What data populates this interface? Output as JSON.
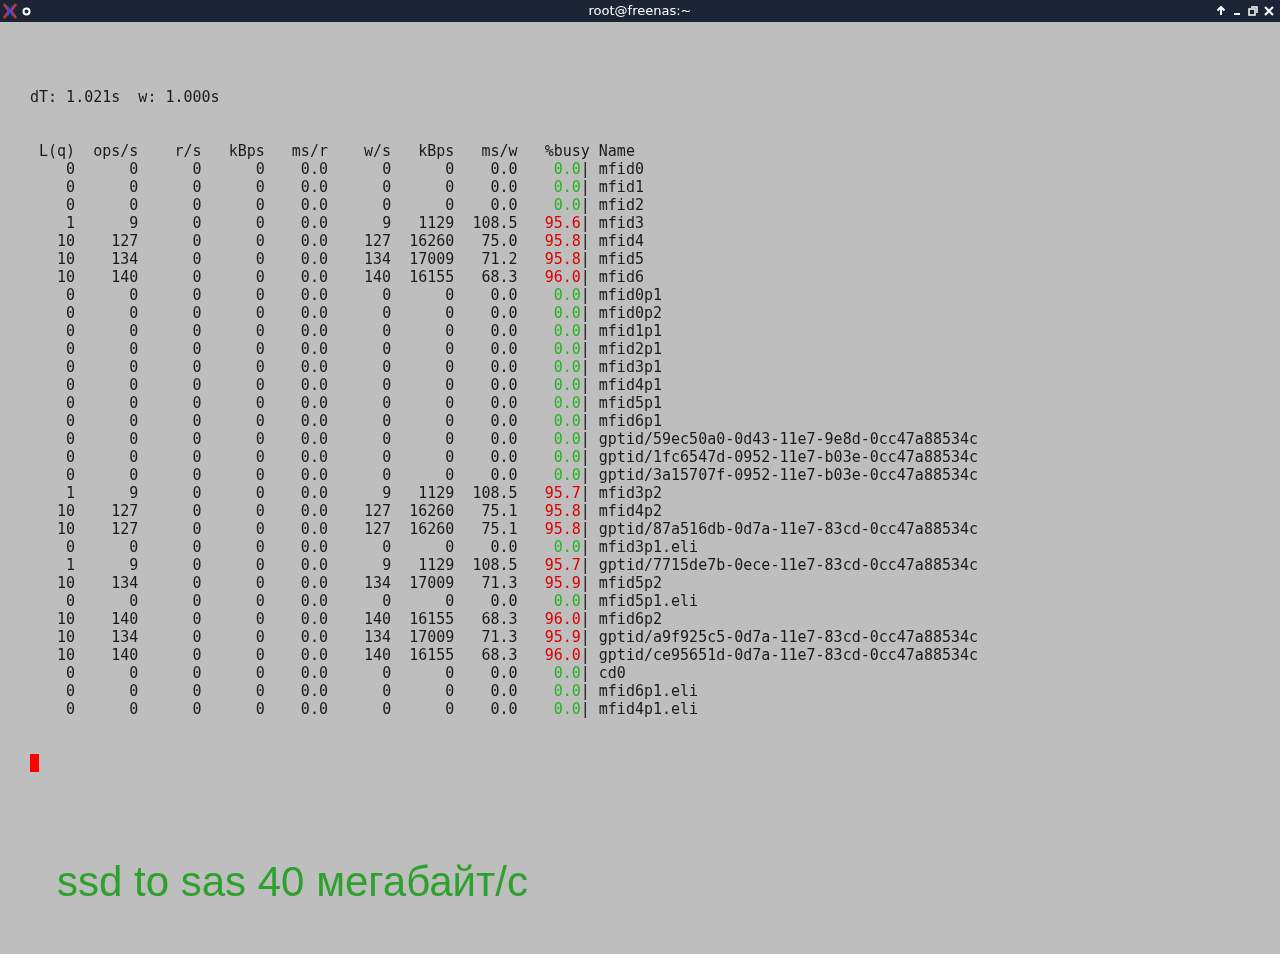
{
  "window": {
    "title": "root@freenas:~"
  },
  "terminal": {
    "status_line": "dT: 1.021s  w: 1.000s",
    "columns": [
      "L(q)",
      "ops/s",
      "r/s",
      "kBps",
      "ms/r",
      "w/s",
      "kBps",
      "ms/w",
      "%busy",
      "Name"
    ],
    "rows": [
      {
        "cells": [
          "0",
          "0",
          "0",
          "0",
          "0.0",
          "0",
          "0",
          "0.0"
        ],
        "busy": "0.0",
        "color": "#22b422",
        "sep": "|",
        "name": "mfid0"
      },
      {
        "cells": [
          "0",
          "0",
          "0",
          "0",
          "0.0",
          "0",
          "0",
          "0.0"
        ],
        "busy": "0.0",
        "color": "#22b422",
        "sep": "|",
        "name": "mfid1"
      },
      {
        "cells": [
          "0",
          "0",
          "0",
          "0",
          "0.0",
          "0",
          "0",
          "0.0"
        ],
        "busy": "0.0",
        "color": "#22b422",
        "sep": "|",
        "name": "mfid2"
      },
      {
        "cells": [
          "1",
          "9",
          "0",
          "0",
          "0.0",
          "9",
          "1129",
          "108.5"
        ],
        "busy": "95.6",
        "color": "#dd0000",
        "sep": "|",
        "name": "mfid3"
      },
      {
        "cells": [
          "10",
          "127",
          "0",
          "0",
          "0.0",
          "127",
          "16260",
          "75.0"
        ],
        "busy": "95.8",
        "color": "#dd0000",
        "sep": "|",
        "name": "mfid4"
      },
      {
        "cells": [
          "10",
          "134",
          "0",
          "0",
          "0.0",
          "134",
          "17009",
          "71.2"
        ],
        "busy": "95.8",
        "color": "#dd0000",
        "sep": "|",
        "name": "mfid5"
      },
      {
        "cells": [
          "10",
          "140",
          "0",
          "0",
          "0.0",
          "140",
          "16155",
          "68.3"
        ],
        "busy": "96.0",
        "color": "#dd0000",
        "sep": "|",
        "name": "mfid6"
      },
      {
        "cells": [
          "0",
          "0",
          "0",
          "0",
          "0.0",
          "0",
          "0",
          "0.0"
        ],
        "busy": "0.0",
        "color": "#22b422",
        "sep": "|",
        "name": "mfid0p1"
      },
      {
        "cells": [
          "0",
          "0",
          "0",
          "0",
          "0.0",
          "0",
          "0",
          "0.0"
        ],
        "busy": "0.0",
        "color": "#22b422",
        "sep": "|",
        "name": "mfid0p2"
      },
      {
        "cells": [
          "0",
          "0",
          "0",
          "0",
          "0.0",
          "0",
          "0",
          "0.0"
        ],
        "busy": "0.0",
        "color": "#22b422",
        "sep": "|",
        "name": "mfid1p1"
      },
      {
        "cells": [
          "0",
          "0",
          "0",
          "0",
          "0.0",
          "0",
          "0",
          "0.0"
        ],
        "busy": "0.0",
        "color": "#22b422",
        "sep": "|",
        "name": "mfid2p1"
      },
      {
        "cells": [
          "0",
          "0",
          "0",
          "0",
          "0.0",
          "0",
          "0",
          "0.0"
        ],
        "busy": "0.0",
        "color": "#22b422",
        "sep": "|",
        "name": "mfid3p1"
      },
      {
        "cells": [
          "0",
          "0",
          "0",
          "0",
          "0.0",
          "0",
          "0",
          "0.0"
        ],
        "busy": "0.0",
        "color": "#22b422",
        "sep": "|",
        "name": "mfid4p1"
      },
      {
        "cells": [
          "0",
          "0",
          "0",
          "0",
          "0.0",
          "0",
          "0",
          "0.0"
        ],
        "busy": "0.0",
        "color": "#22b422",
        "sep": "|",
        "name": "mfid5p1"
      },
      {
        "cells": [
          "0",
          "0",
          "0",
          "0",
          "0.0",
          "0",
          "0",
          "0.0"
        ],
        "busy": "0.0",
        "color": "#22b422",
        "sep": "|",
        "name": "mfid6p1"
      },
      {
        "cells": [
          "0",
          "0",
          "0",
          "0",
          "0.0",
          "0",
          "0",
          "0.0"
        ],
        "busy": "0.0",
        "color": "#22b422",
        "sep": "|",
        "name": "gptid/59ec50a0-0d43-11e7-9e8d-0cc47a88534c"
      },
      {
        "cells": [
          "0",
          "0",
          "0",
          "0",
          "0.0",
          "0",
          "0",
          "0.0"
        ],
        "busy": "0.0",
        "color": "#22b422",
        "sep": "|",
        "name": "gptid/1fc6547d-0952-11e7-b03e-0cc47a88534c"
      },
      {
        "cells": [
          "0",
          "0",
          "0",
          "0",
          "0.0",
          "0",
          "0",
          "0.0"
        ],
        "busy": "0.0",
        "color": "#22b422",
        "sep": "|",
        "name": "gptid/3a15707f-0952-11e7-b03e-0cc47a88534c"
      },
      {
        "cells": [
          "1",
          "9",
          "0",
          "0",
          "0.0",
          "9",
          "1129",
          "108.5"
        ],
        "busy": "95.7",
        "color": "#dd0000",
        "sep": "|",
        "name": "mfid3p2"
      },
      {
        "cells": [
          "10",
          "127",
          "0",
          "0",
          "0.0",
          "127",
          "16260",
          "75.1"
        ],
        "busy": "95.8",
        "color": "#dd0000",
        "sep": "|",
        "name": "mfid4p2"
      },
      {
        "cells": [
          "10",
          "127",
          "0",
          "0",
          "0.0",
          "127",
          "16260",
          "75.1"
        ],
        "busy": "95.8",
        "color": "#dd0000",
        "sep": "|",
        "name": "gptid/87a516db-0d7a-11e7-83cd-0cc47a88534c"
      },
      {
        "cells": [
          "0",
          "0",
          "0",
          "0",
          "0.0",
          "0",
          "0",
          "0.0"
        ],
        "busy": "0.0",
        "color": "#22b422",
        "sep": "|",
        "name": "mfid3p1.eli"
      },
      {
        "cells": [
          "1",
          "9",
          "0",
          "0",
          "0.0",
          "9",
          "1129",
          "108.5"
        ],
        "busy": "95.7",
        "color": "#dd0000",
        "sep": "|",
        "name": "gptid/7715de7b-0ece-11e7-83cd-0cc47a88534c"
      },
      {
        "cells": [
          "10",
          "134",
          "0",
          "0",
          "0.0",
          "134",
          "17009",
          "71.3"
        ],
        "busy": "95.9",
        "color": "#dd0000",
        "sep": "|",
        "name": "mfid5p2"
      },
      {
        "cells": [
          "0",
          "0",
          "0",
          "0",
          "0.0",
          "0",
          "0",
          "0.0"
        ],
        "busy": "0.0",
        "color": "#22b422",
        "sep": "|",
        "name": "mfid5p1.eli"
      },
      {
        "cells": [
          "10",
          "140",
          "0",
          "0",
          "0.0",
          "140",
          "16155",
          "68.3"
        ],
        "busy": "96.0",
        "color": "#dd0000",
        "sep": "|",
        "name": "mfid6p2"
      },
      {
        "cells": [
          "10",
          "134",
          "0",
          "0",
          "0.0",
          "134",
          "17009",
          "71.3"
        ],
        "busy": "95.9",
        "color": "#dd0000",
        "sep": "|",
        "name": "gptid/a9f925c5-0d7a-11e7-83cd-0cc47a88534c"
      },
      {
        "cells": [
          "10",
          "140",
          "0",
          "0",
          "0.0",
          "140",
          "16155",
          "68.3"
        ],
        "busy": "96.0",
        "color": "#dd0000",
        "sep": "|",
        "name": "gptid/ce95651d-0d7a-11e7-83cd-0cc47a88534c"
      },
      {
        "cells": [
          "0",
          "0",
          "0",
          "0",
          "0.0",
          "0",
          "0",
          "0.0"
        ],
        "busy": "0.0",
        "color": "#22b422",
        "sep": "|",
        "name": "cd0"
      },
      {
        "cells": [
          "0",
          "0",
          "0",
          "0",
          "0.0",
          "0",
          "0",
          "0.0"
        ],
        "busy": "0.0",
        "color": "#22b422",
        "sep": "|",
        "name": "mfid6p1.eli"
      },
      {
        "cells": [
          "0",
          "0",
          "0",
          "0",
          "0.0",
          "0",
          "0",
          "0.0"
        ],
        "busy": "0.0",
        "color": "#22b422",
        "sep": "|",
        "name": "mfid4p1.eli"
      }
    ]
  },
  "annotation": "ssd to sas 40 мегабайт/с"
}
